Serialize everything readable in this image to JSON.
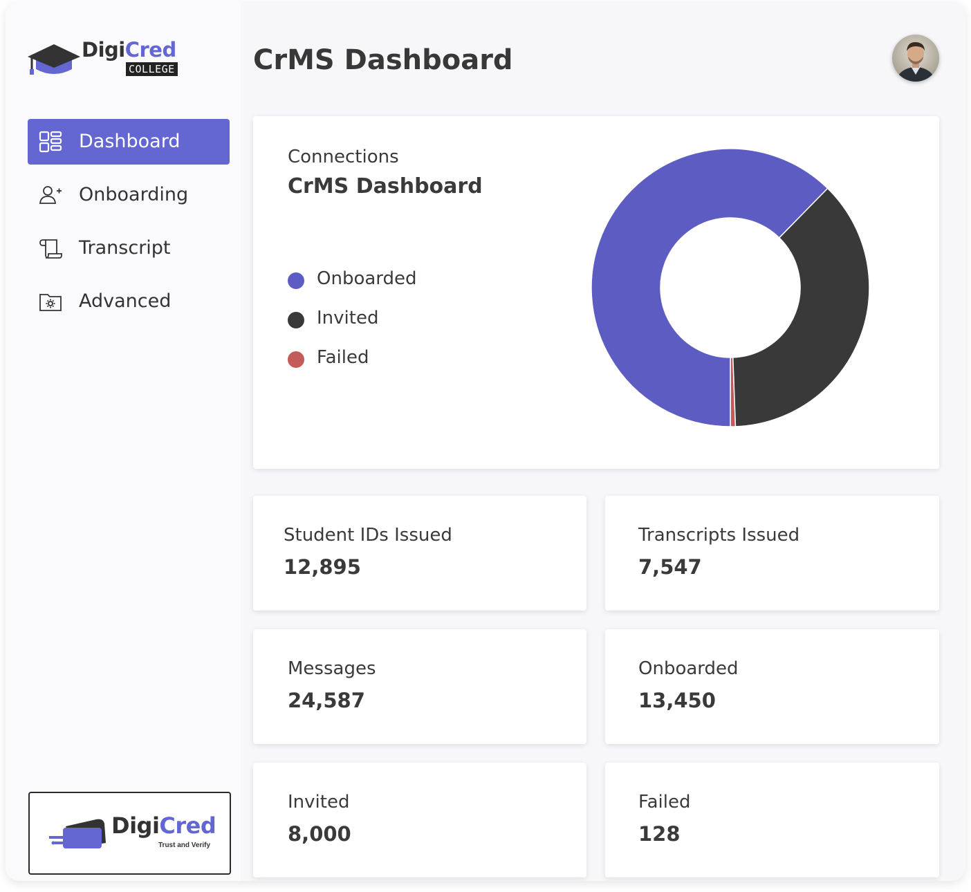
{
  "app": {
    "logo_part1": "Digi",
    "logo_part2": "Cred",
    "logo_sub": "COLLEGE",
    "title": "CrMS Dashboard"
  },
  "sidebar": {
    "items": [
      {
        "label": "Dashboard",
        "icon": "dashboard-grid-icon",
        "active": true
      },
      {
        "label": "Onboarding",
        "icon": "user-plus-icon",
        "active": false
      },
      {
        "label": "Transcript",
        "icon": "scroll-icon",
        "active": false
      },
      {
        "label": "Advanced",
        "icon": "folder-gear-icon",
        "active": false
      }
    ],
    "brand": {
      "part1": "Digi",
      "part2": "Cred",
      "tagline": "Trust and Verify"
    }
  },
  "connections": {
    "subtitle": "Connections",
    "title": "CrMS Dashboard"
  },
  "chart_data": {
    "type": "pie",
    "variant": "donut",
    "categories": [
      "Onboarded",
      "Invited",
      "Failed"
    ],
    "values": [
      13450,
      8000,
      128
    ],
    "colors": [
      "#5c5cc2",
      "#393939",
      "#c55a5a"
    ],
    "legend_position": "left"
  },
  "stats": [
    {
      "label": "Student IDs Issued",
      "value": "12,895"
    },
    {
      "label": "Transcripts Issued",
      "value": "7,547"
    },
    {
      "label": "Messages",
      "value": "24,587"
    },
    {
      "label": "Onboarded",
      "value": "13,450"
    },
    {
      "label": "Invited",
      "value": "8,000"
    },
    {
      "label": "Failed",
      "value": "128"
    }
  ],
  "colors": {
    "accent": "#6466d2",
    "text": "#3a3a3a",
    "background": "#f7f7fa"
  }
}
